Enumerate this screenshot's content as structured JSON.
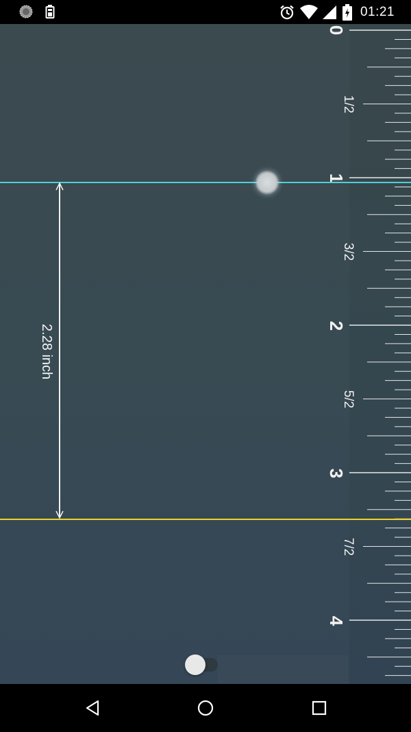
{
  "status_bar": {
    "time": "01:21",
    "left_icons": [
      "spinner-icon",
      "battery-saver-icon"
    ],
    "right_icons": [
      "alarm-icon",
      "wifi-icon",
      "cellular-icon",
      "battery-charging-icon"
    ]
  },
  "ruler": {
    "unit": "inch",
    "whole_labels": [
      "0",
      "1",
      "2",
      "3",
      "4"
    ],
    "half_labels": [
      "1/2",
      "3/2",
      "5/2",
      "7/2"
    ]
  },
  "measurement": {
    "value_label": "2.28 inch"
  },
  "toggle": {
    "state": "off"
  },
  "colors": {
    "top_line": "#4fd1d9",
    "bottom_line": "#f0d22a",
    "background": "#384a52"
  },
  "nav_bar": {
    "buttons": [
      "back-icon",
      "home-icon",
      "recents-icon"
    ]
  }
}
